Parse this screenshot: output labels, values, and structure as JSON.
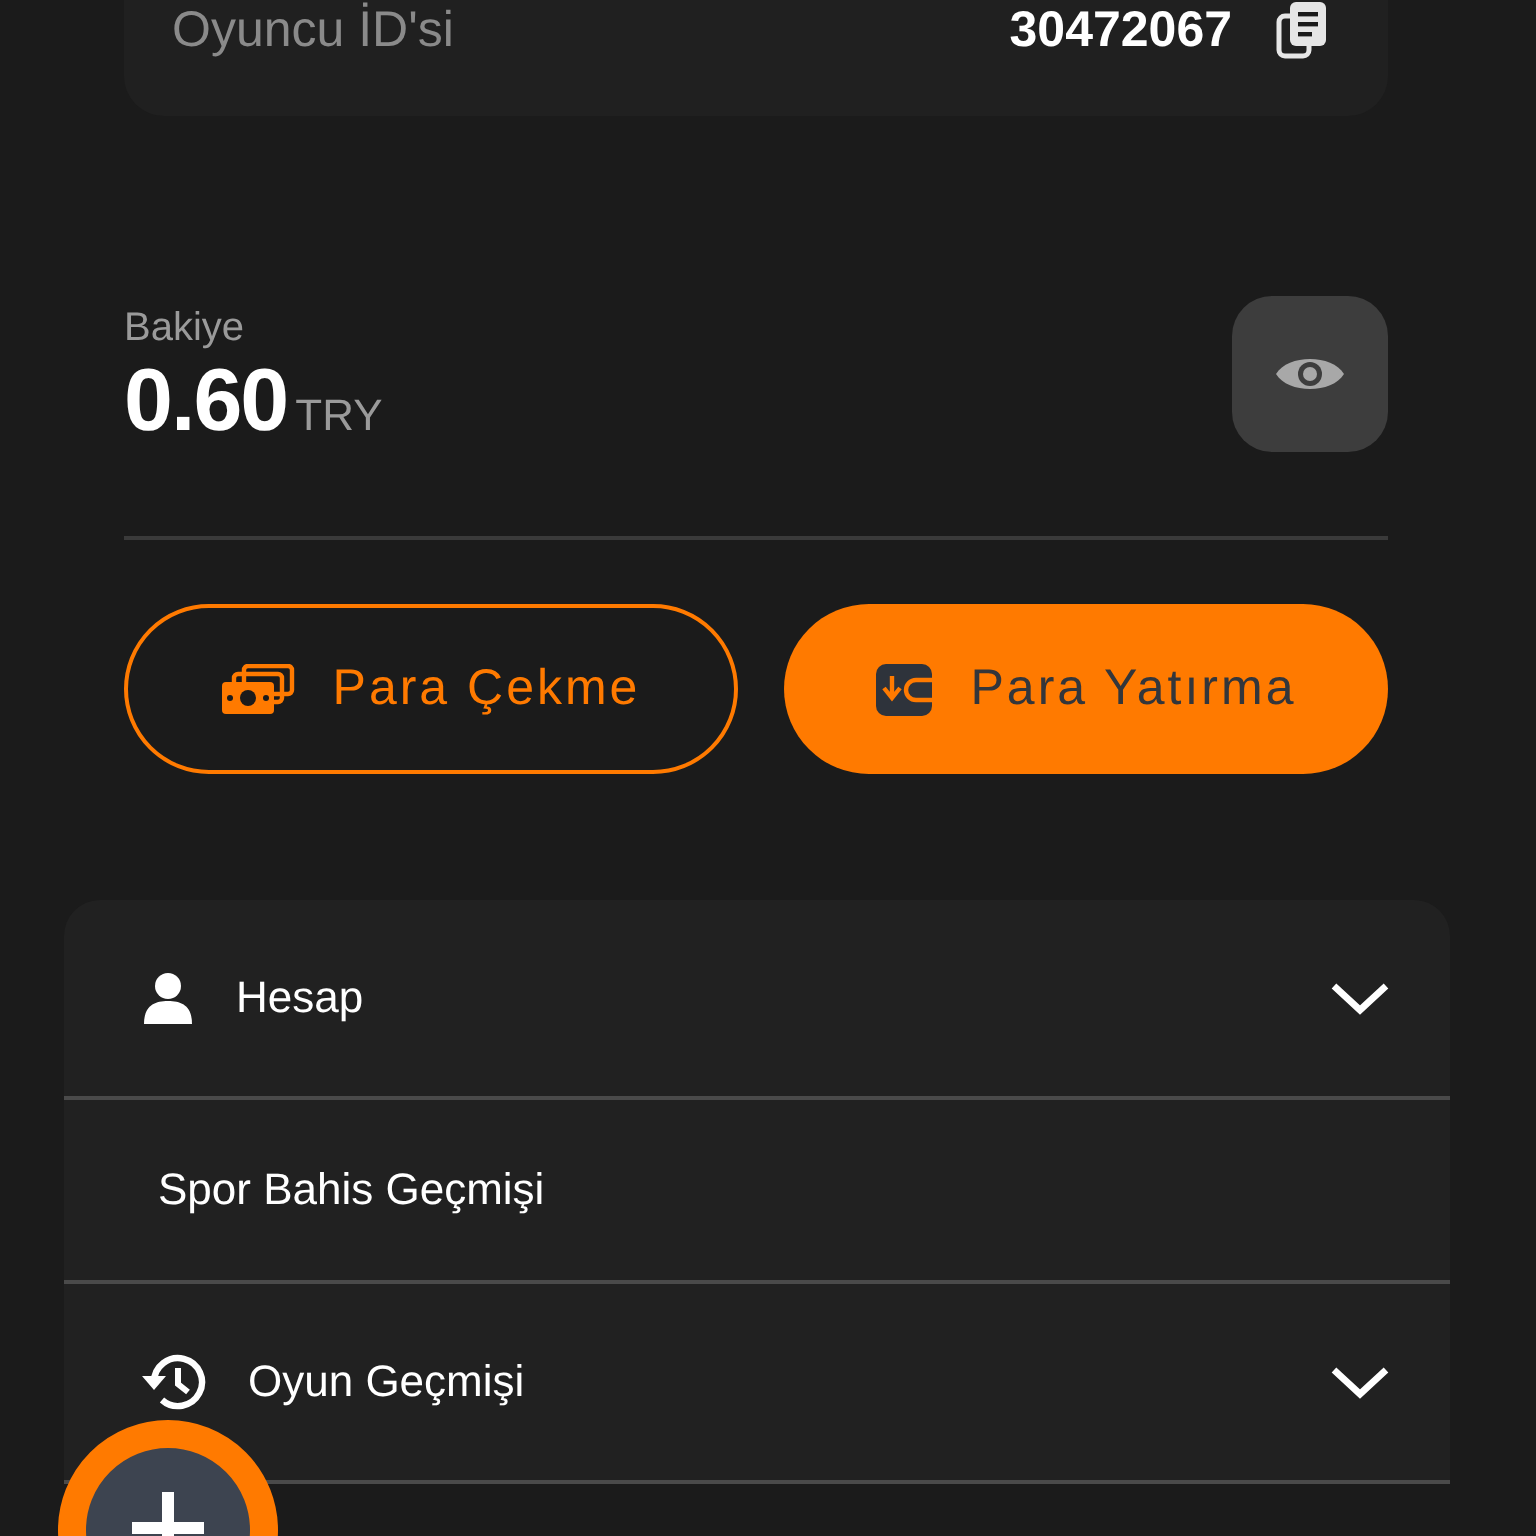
{
  "player_id": {
    "label": "Oyuncu İD'si",
    "value": "30472067"
  },
  "balance": {
    "label": "Bakiye",
    "amount": "0.60",
    "currency": "TRY"
  },
  "actions": [
    {
      "label": "Para Çekme",
      "kind": "withdraw"
    },
    {
      "label": "Para Yatırma",
      "kind": "deposit"
    }
  ],
  "menu": [
    {
      "label": "Hesap",
      "kind": "group"
    },
    {
      "label": "Spor Bahis Geçmişi",
      "kind": "link"
    },
    {
      "label": "Oyun Geçmişi",
      "kind": "group"
    }
  ]
}
